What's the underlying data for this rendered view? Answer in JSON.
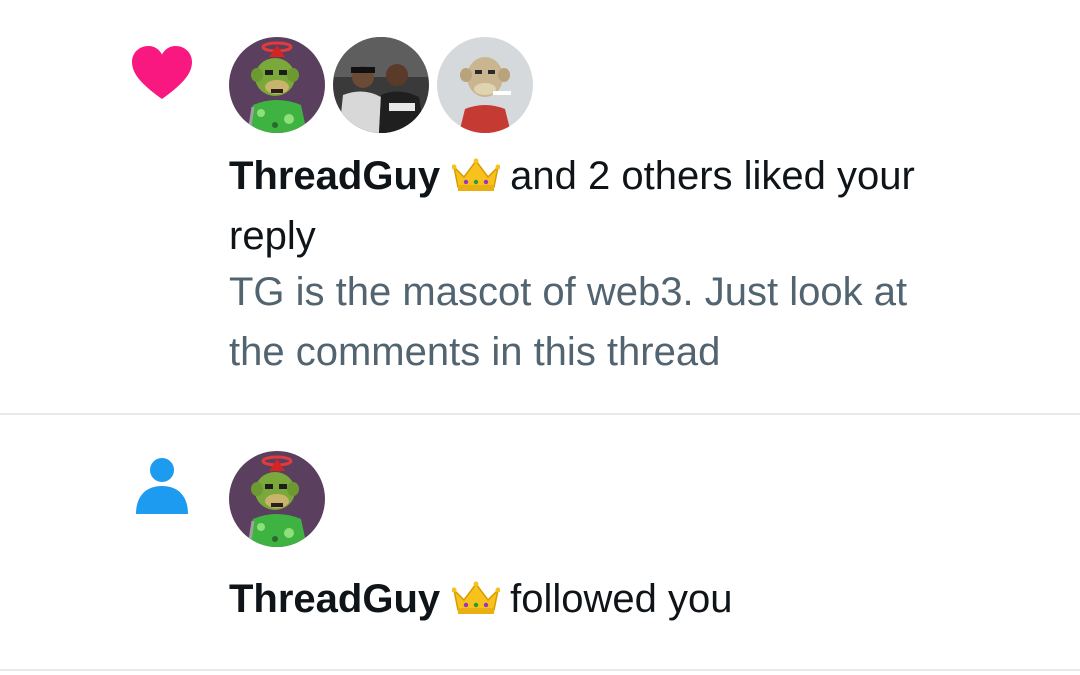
{
  "notifications": [
    {
      "type": "like",
      "icon": "heart-icon",
      "icon_color": "#f91880",
      "avatars": [
        "ThreadGuy",
        "",
        ""
      ],
      "actor": "ThreadGuy",
      "badge": "crown-emoji",
      "action_line1": "and 2 others liked your",
      "action_line2": "reply",
      "preview_line1": "TG is the mascot of web3.  Just look at",
      "preview_line2": "the comments in this thread"
    },
    {
      "type": "follow",
      "icon": "person-icon",
      "icon_color": "#1d9bf0",
      "avatars": [
        "ThreadGuy"
      ],
      "actor": "ThreadGuy",
      "badge": "crown-emoji",
      "action_line1": "followed you"
    }
  ],
  "colors": {
    "text_primary": "#0f1419",
    "text_secondary": "#536471",
    "divider": "#e7e9ea"
  }
}
